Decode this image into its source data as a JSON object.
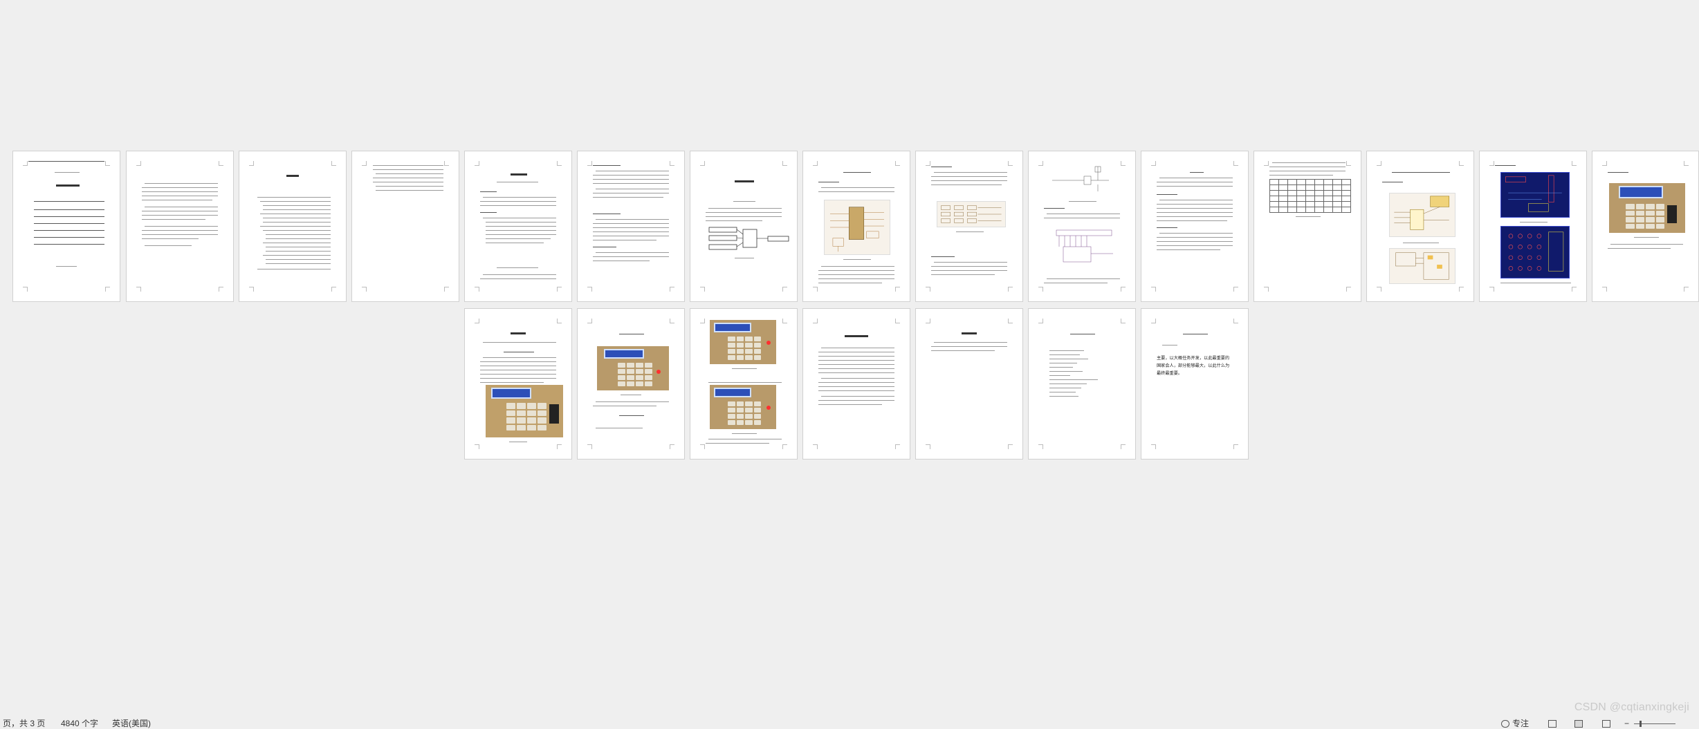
{
  "status_bar": {
    "page_info": "页，共 3 页",
    "word_count": "4840 个字",
    "language": "英语(美国)",
    "focus_label": "专注"
  },
  "watermark": "CSDN @cqtianxingkeji",
  "page_last_text": "主要，以大概任务开发，以此最重要的国家会人，部分能够最大，以此什么为最终最重要。",
  "icons": [
    "focus-icon",
    "print-layout-icon",
    "web-layout-icon",
    "read-mode-icon",
    "zoom-slider"
  ]
}
